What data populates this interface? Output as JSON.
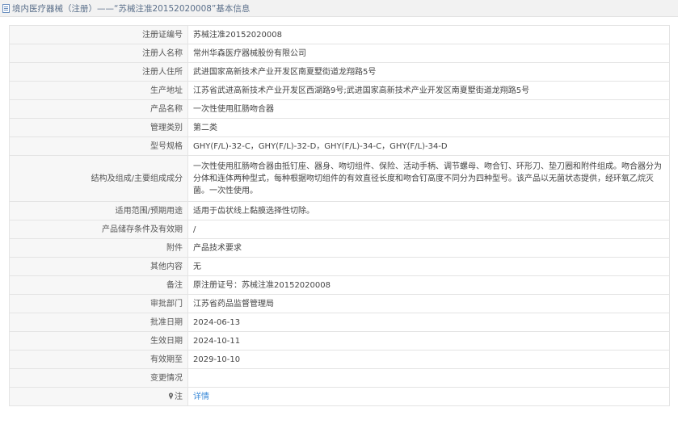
{
  "header": {
    "title": "境内医疗器械（注册）——“苏械注准20152020008”基本信息",
    "icon": "document-icon"
  },
  "rows": [
    {
      "label": "注册证编号",
      "value": "苏械注准20152020008"
    },
    {
      "label": "注册人名称",
      "value": "常州华森医疗器械股份有限公司"
    },
    {
      "label": "注册人住所",
      "value": "武进国家高新技术产业开发区南夏墅街道龙翔路5号"
    },
    {
      "label": "生产地址",
      "value": "江苏省武进高新技术产业开发区西湖路9号;武进国家高新技术产业开发区南夏墅街道龙翔路5号"
    },
    {
      "label": "产品名称",
      "value": "一次性使用肛肠吻合器"
    },
    {
      "label": "管理类别",
      "value": "第二类"
    },
    {
      "label": "型号规格",
      "value": "GHY(F/L)-32-C，GHY(F/L)-32-D，GHY(F/L)-34-C，GHY(F/L)-34-D"
    },
    {
      "label": "结构及组成/主要组成成分",
      "value": "一次性使用肛肠吻合器由抵钉座、器身、吻切组件、保险、活动手柄、调节螺母、吻合钉、环形刀、垫刀圈和附件组成。吻合器分为分体和连体两种型式，每种根据吻切组件的有效直径长度和吻合钉高度不同分为四种型号。该产品以无菌状态提供，经环氧乙烷灭菌。一次性使用。"
    },
    {
      "label": "适用范围/预期用途",
      "value": "适用于齿状线上黏膜选择性切除。"
    },
    {
      "label": "产品储存条件及有效期",
      "value": "/"
    },
    {
      "label": "附件",
      "value": "产品技术要求"
    },
    {
      "label": "其他内容",
      "value": "无"
    },
    {
      "label": "备注",
      "value": "原注册证号：苏械注准20152020008"
    },
    {
      "label": "审批部门",
      "value": "江苏省药品监督管理局"
    },
    {
      "label": "批准日期",
      "value": "2024-06-13"
    },
    {
      "label": "生效日期",
      "value": "2024-10-11"
    },
    {
      "label": "有效期至",
      "value": "2029-10-10"
    },
    {
      "label": "变更情况",
      "value": ""
    }
  ],
  "footer_row": {
    "label": "注",
    "label_icon": "pin-icon",
    "link_text": "详情"
  },
  "colors": {
    "title_text": "#5a6f8a",
    "label_bg": "#f7f7f7",
    "border": "#e4e4e4",
    "link": "#3a8ad8"
  }
}
